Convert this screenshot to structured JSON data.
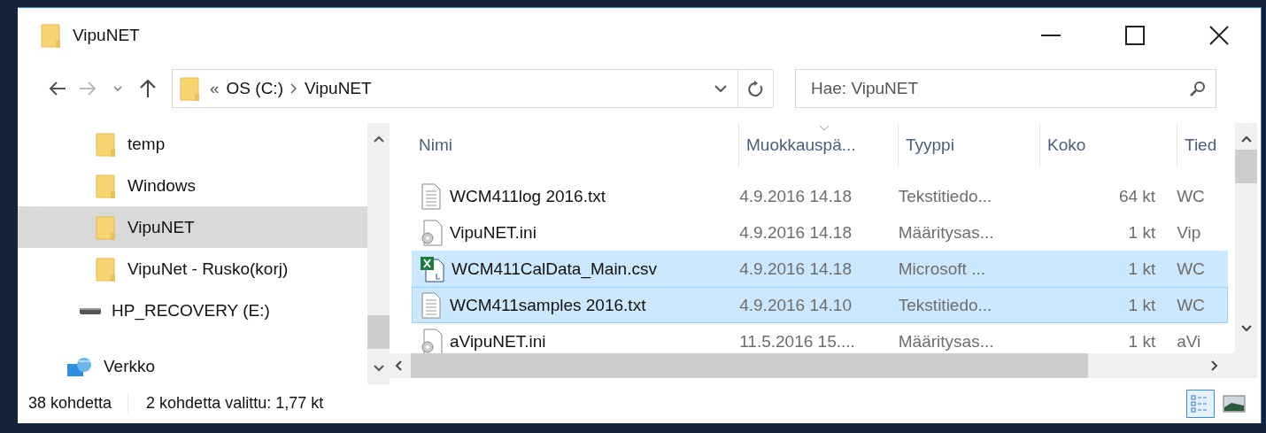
{
  "window": {
    "title": "VipuNET"
  },
  "toolbar": {
    "path_overflow": "«",
    "path": [
      "OS (C:)",
      "VipuNET"
    ],
    "search": {
      "placeholder": "Hae: VipuNET"
    }
  },
  "navigation": {
    "items": [
      {
        "label": "temp",
        "kind": "folder",
        "selected": false
      },
      {
        "label": "Windows",
        "kind": "folder",
        "selected": false
      },
      {
        "label": "VipuNET",
        "kind": "folder",
        "selected": true
      },
      {
        "label": "VipuNet - Rusko(korj)",
        "kind": "folder",
        "selected": false
      },
      {
        "label": "HP_RECOVERY (E:)",
        "kind": "drive",
        "selected": false
      },
      {
        "label": "Verkko",
        "kind": "network",
        "selected": false
      }
    ]
  },
  "file_list": {
    "columns": [
      {
        "label": "Nimi",
        "sorted": false
      },
      {
        "label": "Muokkauspä...",
        "sorted": true
      },
      {
        "label": "Tyyppi",
        "sorted": false
      },
      {
        "label": "Koko",
        "sorted": false
      },
      {
        "label": "Tied",
        "sorted": false
      }
    ],
    "rows": [
      {
        "kind": "text",
        "name": "WCM411log 2016.txt",
        "modified": "4.9.2016 14.18",
        "type": "Tekstitiedo...",
        "size": "64 kt",
        "column_5": "WC",
        "selected": false,
        "focused": false
      },
      {
        "kind": "settings",
        "name": "VipuNET.ini",
        "modified": "4.9.2016 14.18",
        "type": "Määritysas...",
        "size": "1 kt",
        "column_5": "Vip",
        "selected": false,
        "focused": false
      },
      {
        "kind": "spreadsheet",
        "name": "WCM411CalData_Main.csv",
        "modified": "4.9.2016 14.18",
        "type": "Microsoft ...",
        "size": "1 kt",
        "column_5": "WC",
        "selected": true,
        "focused": false
      },
      {
        "kind": "text",
        "name": "WCM411samples 2016.txt",
        "modified": "4.9.2016 14.10",
        "type": "Tekstitiedo...",
        "size": "1 kt",
        "column_5": "WC",
        "selected": true,
        "focused": true
      },
      {
        "kind": "settings",
        "name": "aVipuNET.ini",
        "modified": "11.5.2016 15....",
        "type": "Määritysas...",
        "size": "1 kt",
        "column_5": "aVi",
        "selected": false,
        "focused": false
      }
    ]
  },
  "status_bar": {
    "count": "38 kohdetta",
    "selection": "2 kohdetta valittu: 1,77 kt"
  },
  "view_buttons": [
    {
      "kind": "details",
      "selected": true
    },
    {
      "kind": "large-icons",
      "selected": false
    }
  ]
}
